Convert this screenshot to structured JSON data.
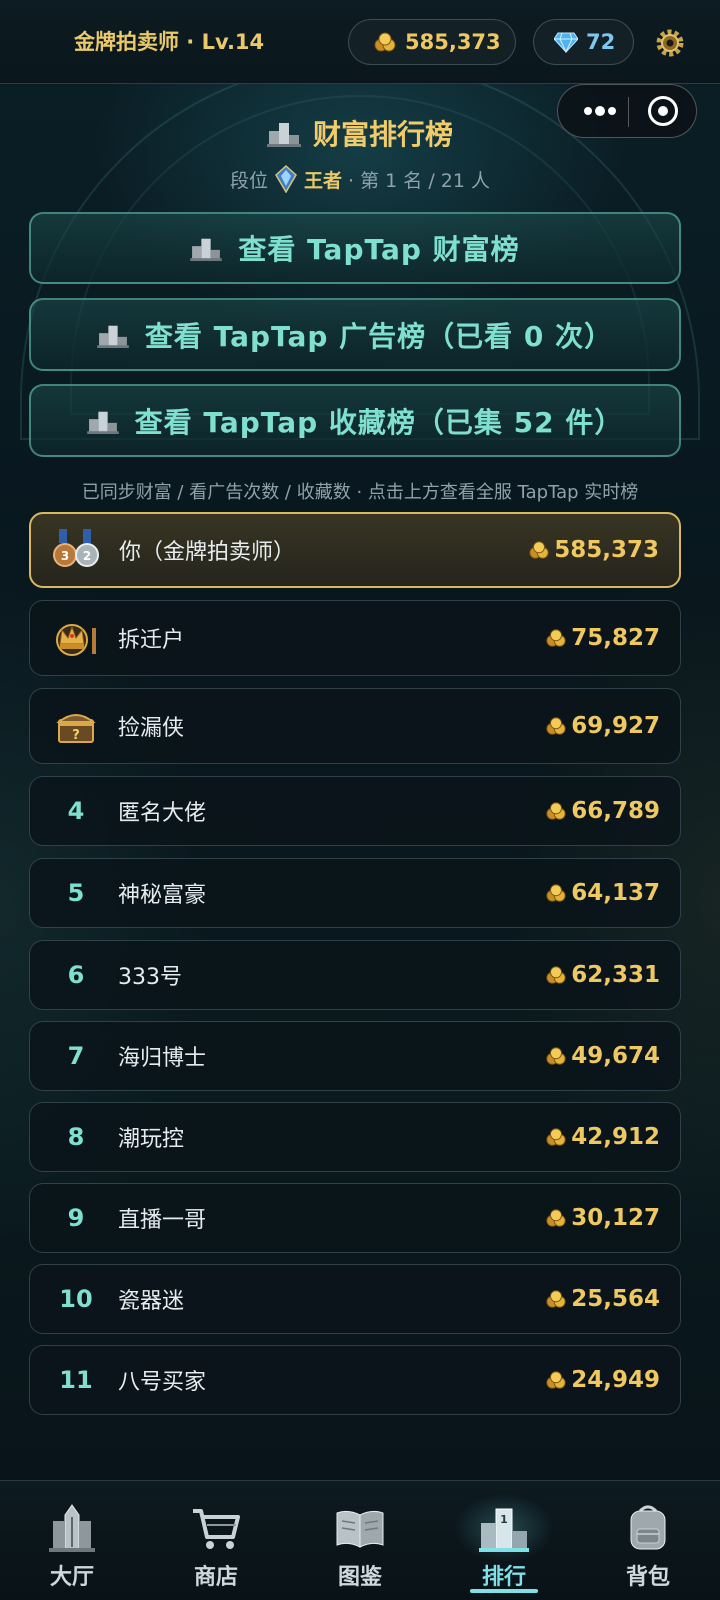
{
  "header": {
    "player_label": "金牌拍卖师 · Lv.14",
    "coins": "585,373",
    "gems": "72"
  },
  "leaderboard": {
    "title": "财富排行榜",
    "rank_prefix": "段位",
    "tier": "王者",
    "rank_suffix": "· 第 1 名 / 21 人"
  },
  "buttons": [
    {
      "label": "查看 TapTap 财富榜"
    },
    {
      "label": "查看 TapTap 广告榜（已看 0 次）"
    },
    {
      "label": "查看 TapTap 收藏榜（已集 52 件）"
    }
  ],
  "note": "已同步财富 / 看广告次数 / 收藏数 · 点击上方查看全服 TapTap 实时榜",
  "rows": [
    {
      "rank": "",
      "badge": "medals",
      "name": "你（金牌拍卖师）",
      "score": "585,373"
    },
    {
      "rank": "",
      "badge": "crown",
      "name": "拆迁户",
      "score": "75,827"
    },
    {
      "rank": "",
      "badge": "chest",
      "name": "捡漏侠",
      "score": "69,927"
    },
    {
      "rank": "4",
      "name": "匿名大佬",
      "score": "66,789"
    },
    {
      "rank": "5",
      "name": "神秘富豪",
      "score": "64,137"
    },
    {
      "rank": "6",
      "name": "333号",
      "score": "62,331"
    },
    {
      "rank": "7",
      "name": "海归博士",
      "score": "49,674"
    },
    {
      "rank": "8",
      "name": "潮玩控",
      "score": "42,912"
    },
    {
      "rank": "9",
      "name": "直播一哥",
      "score": "30,127"
    },
    {
      "rank": "10",
      "name": "瓷器迷",
      "score": "25,564"
    },
    {
      "rank": "11",
      "name": "八号买家",
      "score": "24,949"
    }
  ],
  "tabs": [
    {
      "label": "大厅",
      "icon": "building-icon"
    },
    {
      "label": "商店",
      "icon": "cart-icon"
    },
    {
      "label": "图鉴",
      "icon": "book-icon"
    },
    {
      "label": "排行",
      "icon": "podium-icon",
      "active": true
    },
    {
      "label": "背包",
      "icon": "backpack-icon"
    }
  ],
  "colors": {
    "gold": "#f0c862",
    "teal": "#7fe0cf",
    "background": "#06121a"
  }
}
